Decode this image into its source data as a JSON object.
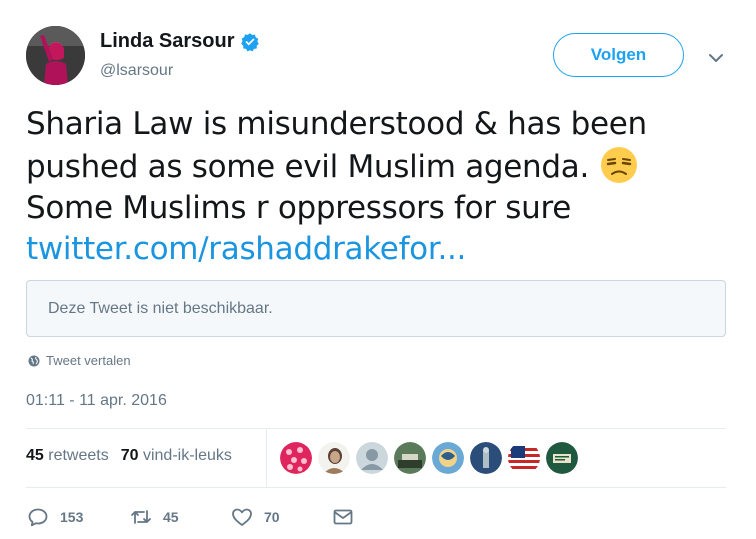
{
  "author": {
    "display_name": "Linda Sarsour",
    "handle": "@lsarsour",
    "verified": true
  },
  "follow_button": {
    "label": "Volgen"
  },
  "tweet": {
    "lines": [
      "Sharia Law is misunderstood & has been",
      "pushed as some evil Muslim agenda.",
      "Some Muslims r oppressors for sure"
    ],
    "emoji": "unamused-face",
    "link": "twitter.com/rashaddrakefor..."
  },
  "quoted_tweet": {
    "text": "Deze Tweet is niet beschikbaar."
  },
  "translate": {
    "label": "Tweet vertalen"
  },
  "timestamp": "01:11 - 11 apr. 2016",
  "stats": {
    "retweets_count": "45",
    "retweets_label": "retweets",
    "likes_count": "70",
    "likes_label": "vind-ik-leuks"
  },
  "liker_avatars": [
    "avatar-1",
    "avatar-2",
    "avatar-3",
    "avatar-4",
    "avatar-5",
    "avatar-6",
    "avatar-7",
    "avatar-8"
  ],
  "actions": {
    "reply_count": "153",
    "retweet_count": "45",
    "like_count": "70"
  },
  "colors": {
    "accent": "#1da1f2",
    "link": "#1b95e0",
    "text": "#14171a",
    "secondary": "#657786",
    "border": "#e6ecf0"
  }
}
